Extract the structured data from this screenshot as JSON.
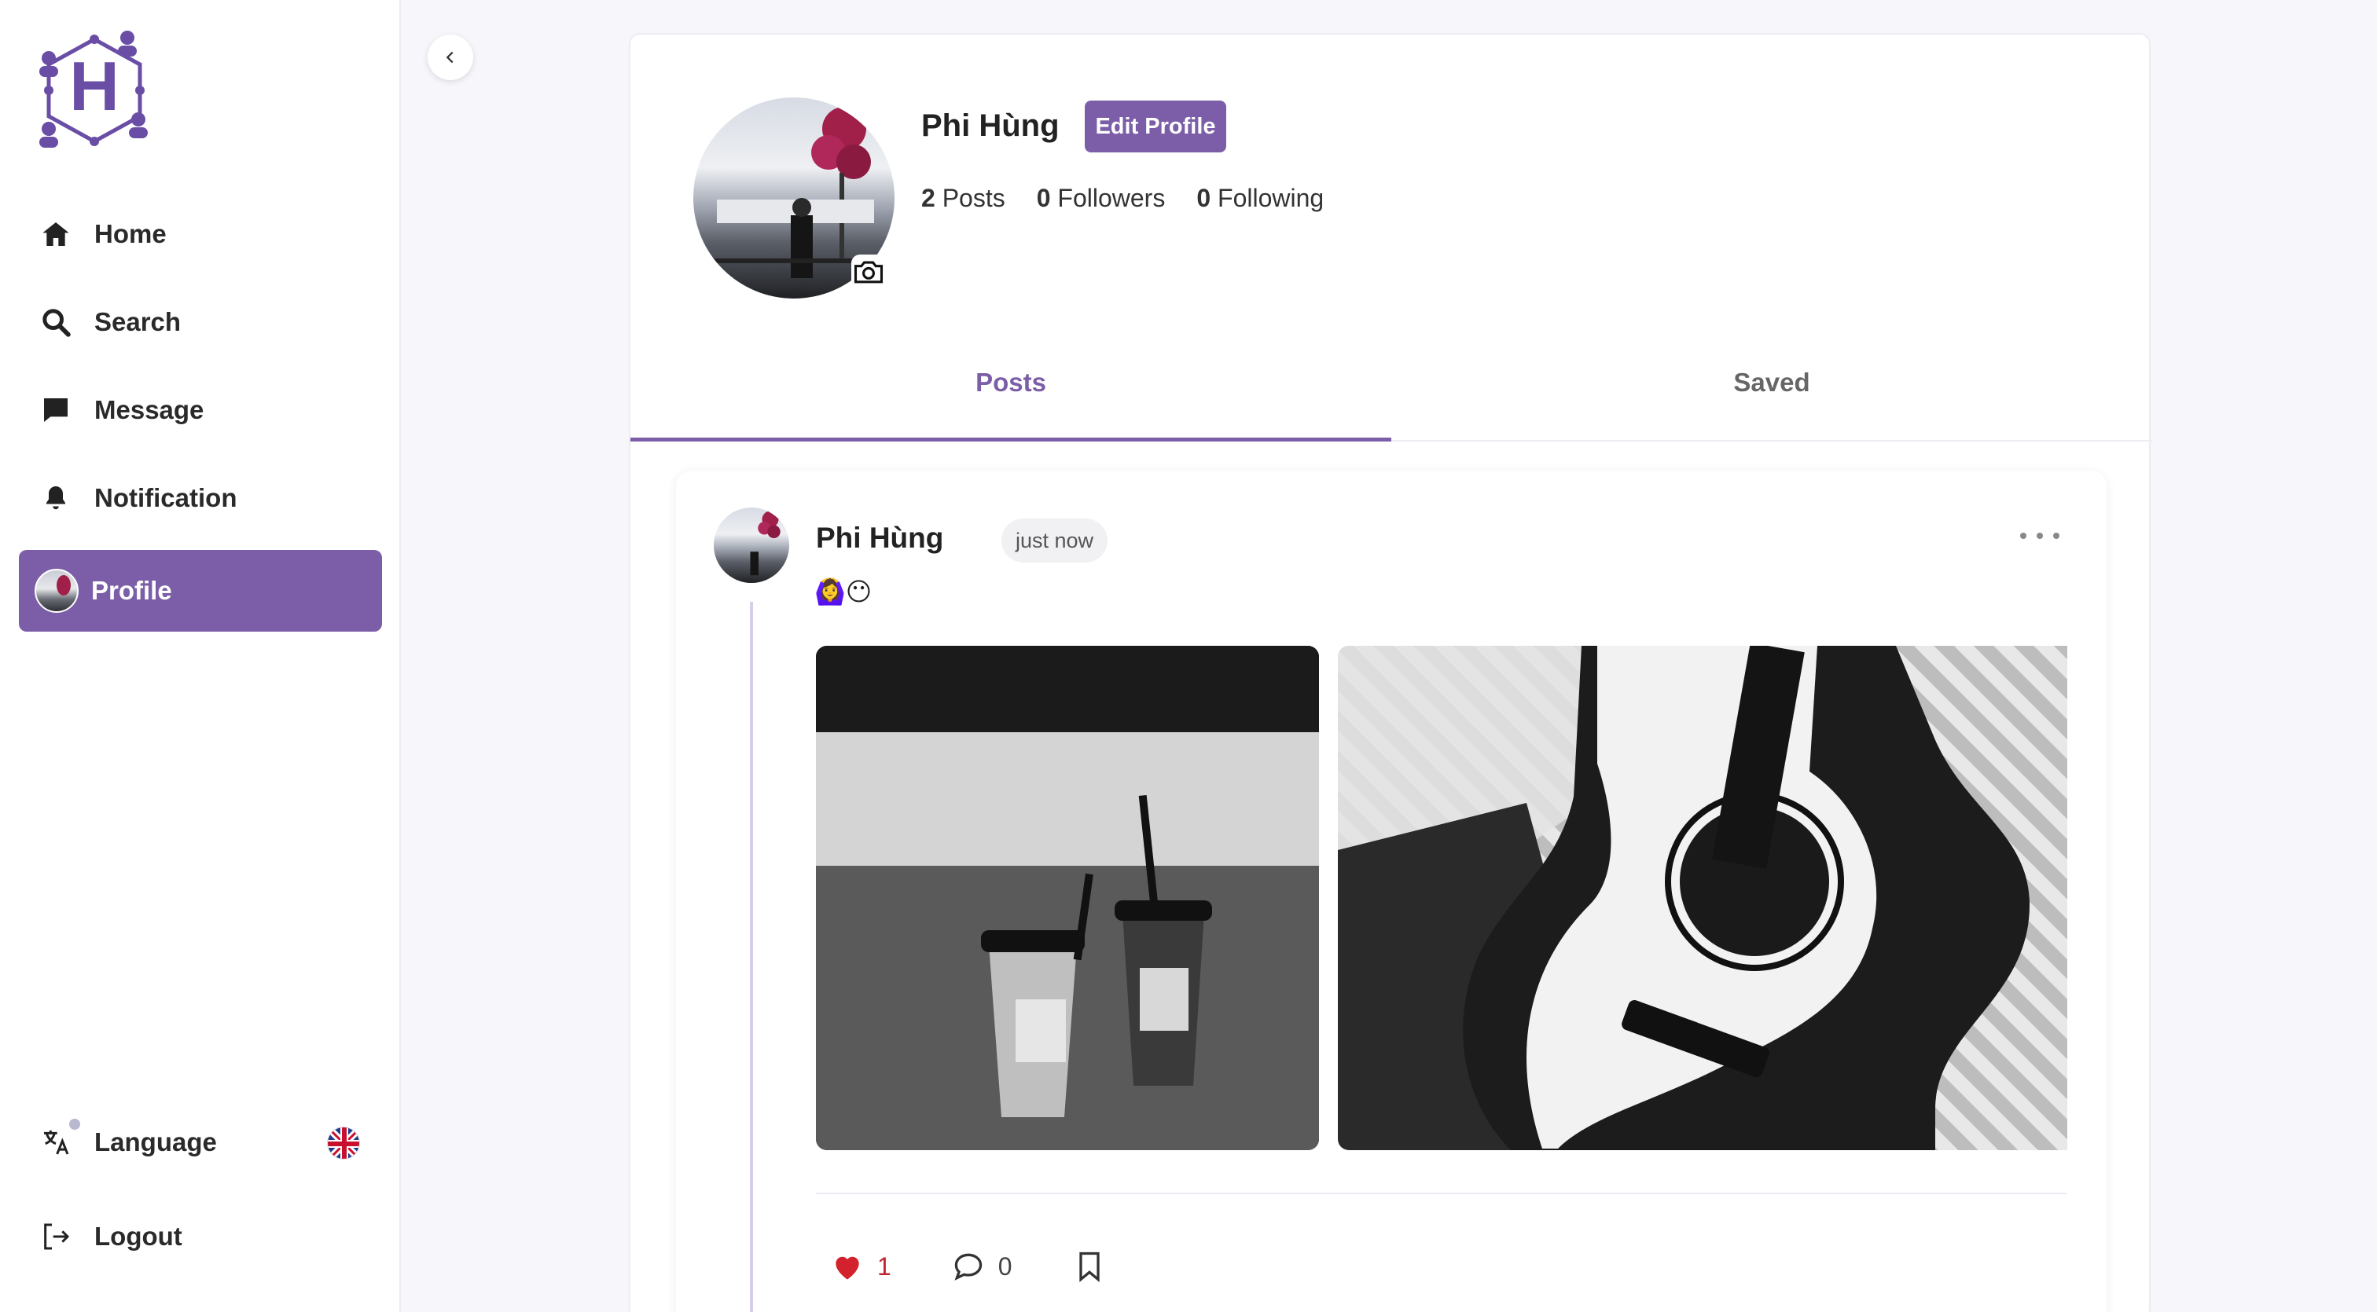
{
  "sidebar": {
    "items": [
      {
        "label": "Home",
        "icon": "home-icon"
      },
      {
        "label": "Search",
        "icon": "search-icon"
      },
      {
        "label": "Message",
        "icon": "message-icon"
      },
      {
        "label": "Notification",
        "icon": "bell-icon"
      },
      {
        "label": "Profile",
        "icon": "avatar"
      }
    ],
    "language_label": "Language",
    "logout_label": "Logout"
  },
  "profile": {
    "name": "Phi Hùng",
    "edit_label": "Edit Profile",
    "posts_count": "2",
    "posts_label": "Posts",
    "followers_count": "0",
    "followers_label": "Followers",
    "following_count": "0",
    "following_label": "Following"
  },
  "tabs": [
    {
      "label": "Posts",
      "active": true
    },
    {
      "label": "Saved",
      "active": false
    }
  ],
  "post": {
    "author": "Phi Hùng",
    "time": "just now",
    "text": "🙆‍♀️😶",
    "likes": "1",
    "comments": "0"
  },
  "colors": {
    "accent": "#7b5ea7",
    "like": "#c0242e"
  }
}
